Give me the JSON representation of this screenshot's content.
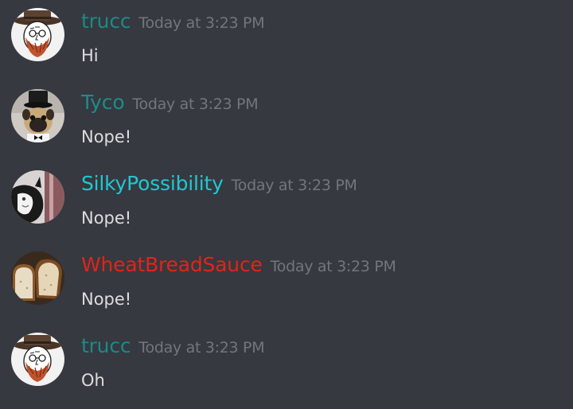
{
  "colors": {
    "background": "#36393f",
    "timestamp": "#72767d",
    "message_text": "#dcddde"
  },
  "messages": [
    {
      "author": "trucc",
      "author_color": "#1a8a8a",
      "avatar_icon": "bearded-man-hat-avatar",
      "timestamp": "Today at 3:23 PM",
      "content": "Hi"
    },
    {
      "author": "Tyco",
      "author_color": "#1f8b8b",
      "avatar_icon": "pug-top-hat-avatar",
      "timestamp": "Today at 3:23 PM",
      "content": "Nope!"
    },
    {
      "author": "SilkyPossibility",
      "author_color": "#22c7d1",
      "avatar_icon": "cat-photo-avatar",
      "timestamp": "Today at 3:23 PM",
      "content": "Nope!"
    },
    {
      "author": "WheatBreadSauce",
      "author_color": "#e2231a",
      "avatar_icon": "bread-slices-avatar",
      "timestamp": "Today at 3:23 PM",
      "content": "Nope!"
    },
    {
      "author": "trucc",
      "author_color": "#1a8a8a",
      "avatar_icon": "bearded-man-hat-avatar",
      "timestamp": "Today at 3:23 PM",
      "content": "Oh"
    }
  ]
}
